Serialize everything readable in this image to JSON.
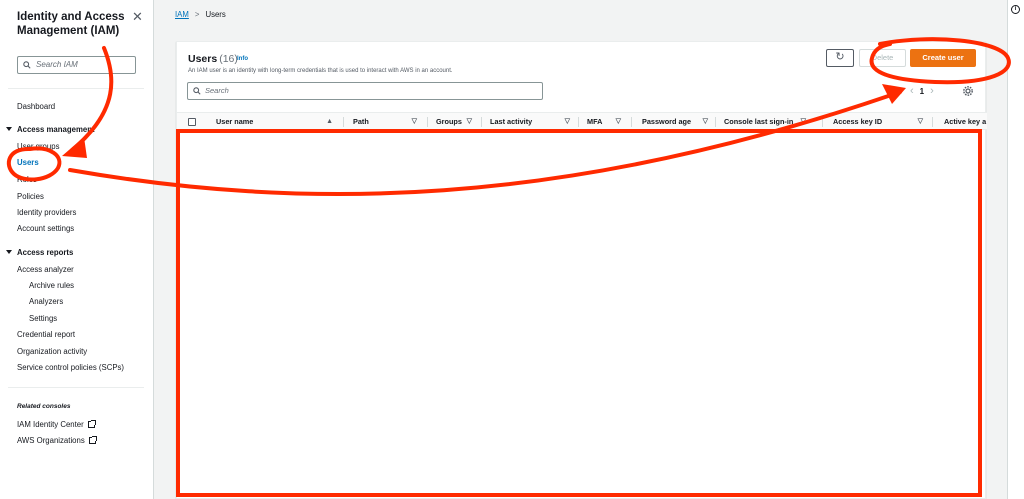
{
  "sidebar": {
    "title": "Identity and Access Management (IAM)",
    "search_placeholder": "Search IAM",
    "dashboard": "Dashboard",
    "access_management": "Access management",
    "user_groups": "User groups",
    "users": "Users",
    "roles": "Roles",
    "policies": "Policies",
    "identity_providers": "Identity providers",
    "account_settings": "Account settings",
    "access_reports": "Access reports",
    "access_analyzer": "Access analyzer",
    "archive_rules": "Archive rules",
    "analyzers": "Analyzers",
    "settings": "Settings",
    "credential_report": "Credential report",
    "organization_activity": "Organization activity",
    "service_control_policies": "Service control policies (SCPs)",
    "related_consoles": "Related consoles",
    "iam_identity_center": "IAM Identity Center",
    "aws_organizations": "AWS Organizations"
  },
  "breadcrumb": {
    "root": "IAM",
    "current": "Users"
  },
  "panel": {
    "title": "Users",
    "count": "(16)",
    "info": "Info",
    "description": "An IAM user is an identity with long-term credentials that is used to interact with AWS in an account.",
    "search_placeholder": "Search",
    "delete_label": "Delete",
    "create_label": "Create user",
    "page": "1"
  },
  "table": {
    "columns": [
      "User name",
      "Path",
      "Groups",
      "Last activity",
      "MFA",
      "Password age",
      "Console last sign-in",
      "Access key ID",
      "Active key a"
    ]
  },
  "colors": {
    "accent": "#ec7211",
    "link": "#0073bb",
    "annotation": "#ff2a00"
  }
}
